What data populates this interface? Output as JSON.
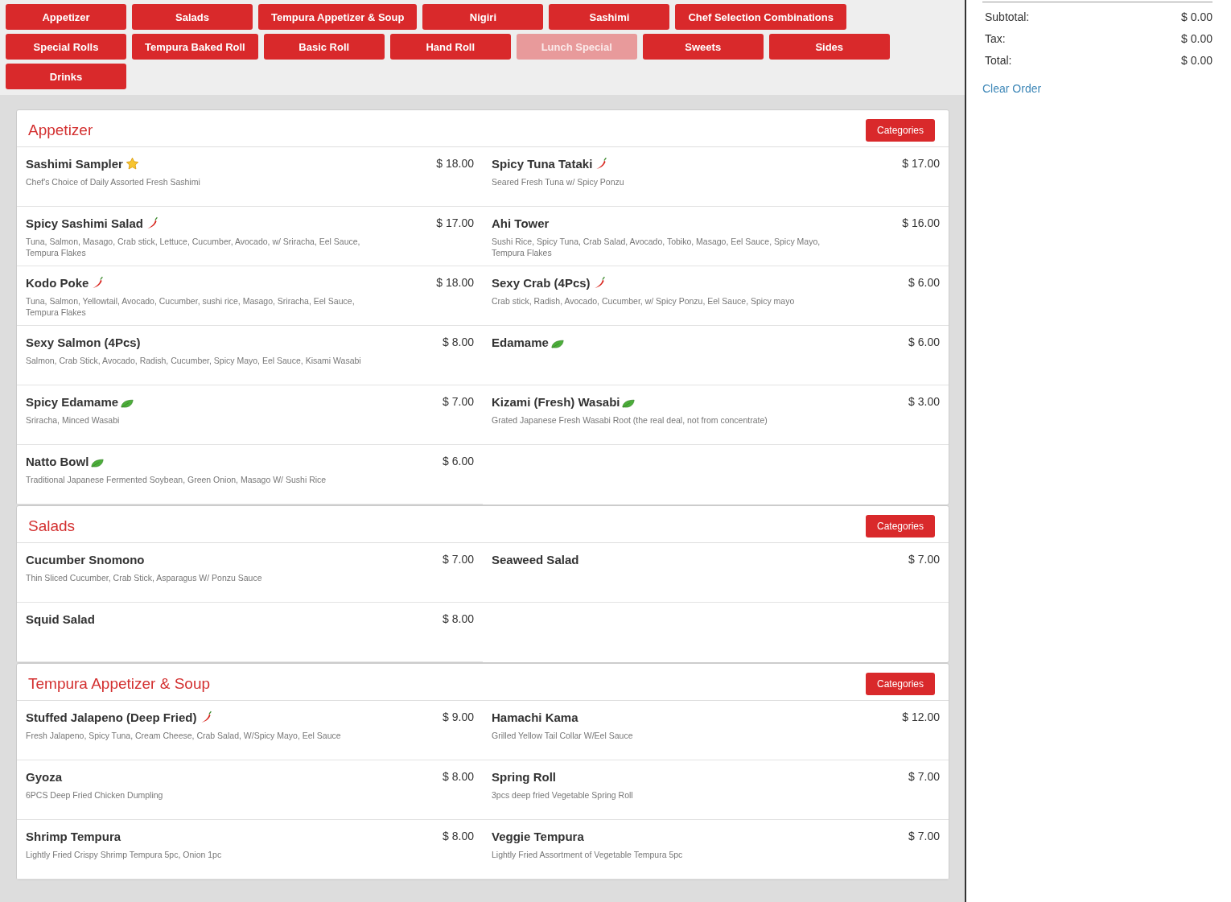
{
  "categories": [
    {
      "label": "Appetizer",
      "disabled": false
    },
    {
      "label": "Salads",
      "disabled": false
    },
    {
      "label": "Tempura Appetizer & Soup",
      "disabled": false
    },
    {
      "label": "Nigiri",
      "disabled": false
    },
    {
      "label": "Sashimi",
      "disabled": false
    },
    {
      "label": "Chef Selection Combinations",
      "disabled": false
    },
    {
      "label": "Special Rolls",
      "disabled": false
    },
    {
      "label": "Tempura Baked Roll",
      "disabled": false
    },
    {
      "label": "Basic Roll",
      "disabled": false
    },
    {
      "label": "Hand Roll",
      "disabled": false
    },
    {
      "label": "Lunch Special",
      "disabled": true
    },
    {
      "label": "Sweets",
      "disabled": false
    },
    {
      "label": "Sides",
      "disabled": false
    },
    {
      "label": "Drinks",
      "disabled": false
    }
  ],
  "sections": [
    {
      "title": "Appetizer",
      "button": "Categories",
      "items": [
        {
          "name": "Sashimi Sampler",
          "kind": "star",
          "price": "$ 18.00",
          "description": "Chef's Choice of Daily Assorted Fresh Sashimi"
        },
        {
          "name": "Spicy Tuna Tataki",
          "kind": "spicy",
          "price": "$ 17.00",
          "description": "Seared Fresh Tuna w/ Spicy Ponzu"
        },
        {
          "name": "Spicy Sashimi Salad",
          "kind": "spicy",
          "price": "$ 17.00",
          "description": "Tuna, Salmon, Masago, Crab stick, Lettuce, Cucumber, Avocado, w/ Sriracha, Eel Sauce, Tempura Flakes"
        },
        {
          "name": "Ahi Tower",
          "kind": "plain",
          "price": "$ 16.00",
          "description": "Sushi Rice, Spicy Tuna, Crab Salad, Avocado, Tobiko, Masago, Eel Sauce, Spicy Mayo, Tempura Flakes"
        },
        {
          "name": "Kodo Poke",
          "kind": "spicy",
          "price": "$ 18.00",
          "description": "Tuna, Salmon, Yellowtail, Avocado, Cucumber, sushi rice, Masago, Sriracha, Eel Sauce, Tempura Flakes"
        },
        {
          "name": "Sexy Crab (4Pcs)",
          "kind": "spicy",
          "price": "$ 6.00",
          "description": "Crab stick, Radish, Avocado, Cucumber, w/ Spicy Ponzu, Eel Sauce, Spicy mayo"
        },
        {
          "name": "Sexy Salmon (4Pcs)",
          "kind": "plain",
          "price": "$ 8.00",
          "description": "Salmon, Crab Stick, Avocado, Radish, Cucumber, Spicy Mayo, Eel Sauce, Kisami Wasabi"
        },
        {
          "name": "Edamame",
          "kind": "vegan",
          "price": "$ 6.00"
        },
        {
          "name": "Spicy Edamame",
          "kind": "vegan",
          "price": "$ 7.00",
          "description": "Sriracha, Minced Wasabi"
        },
        {
          "name": "Kizami (Fresh) Wasabi",
          "kind": "vegan",
          "price": "$ 3.00",
          "description": "Grated Japanese Fresh Wasabi Root (the real deal, not from concentrate)"
        },
        {
          "name": "Natto Bowl",
          "kind": "vegan",
          "price": "$ 6.00",
          "description": "Traditional Japanese Fermented Soybean, Green Onion, Masago W/ Sushi Rice"
        }
      ]
    },
    {
      "title": "Salads",
      "button": "Categories",
      "items": [
        {
          "name": "Cucumber Snomono",
          "kind": "plain",
          "price": "$ 7.00",
          "description": "Thin Sliced Cucumber, Crab Stick, Asparagus W/ Ponzu Sauce"
        },
        {
          "name": "Seaweed Salad",
          "kind": "plain",
          "price": "$ 7.00"
        },
        {
          "name": "Squid Salad",
          "kind": "plain",
          "price": "$ 8.00"
        }
      ]
    },
    {
      "title": "Tempura Appetizer & Soup",
      "button": "Categories",
      "items": [
        {
          "name": "Stuffed Jalapeno (Deep Fried)",
          "kind": "spicy",
          "price": "$ 9.00",
          "description": "Fresh Jalapeno, Spicy Tuna, Cream Cheese, Crab Salad, W/Spicy Mayo, Eel Sauce"
        },
        {
          "name": "Hamachi Kama",
          "kind": "plain",
          "price": "$ 12.00",
          "description": "Grilled Yellow Tail Collar W/Eel Sauce"
        },
        {
          "name": "Gyoza",
          "kind": "plain",
          "price": "$ 8.00",
          "description": "6PCS Deep Fried Chicken Dumpling"
        },
        {
          "name": "Spring Roll",
          "kind": "plain",
          "price": "$ 7.00",
          "description": "3pcs deep fried Vegetable Spring Roll"
        },
        {
          "name": "Shrimp Tempura",
          "kind": "plain",
          "price": "$ 8.00",
          "description": "Lightly Fried Crispy Shrimp Tempura 5pc, Onion 1pc"
        },
        {
          "name": "Veggie Tempura",
          "kind": "plain",
          "price": "$ 7.00",
          "description": "Lightly Fried Assortment of Vegetable Tempura 5pc"
        }
      ]
    }
  ],
  "order": {
    "rows": [
      {
        "label": "Subtotal:",
        "value": "$ 0.00"
      },
      {
        "label": "Tax:",
        "value": "$ 0.00"
      },
      {
        "label": "Total:",
        "value": "$ 0.00"
      }
    ],
    "clear": "Clear Order"
  }
}
